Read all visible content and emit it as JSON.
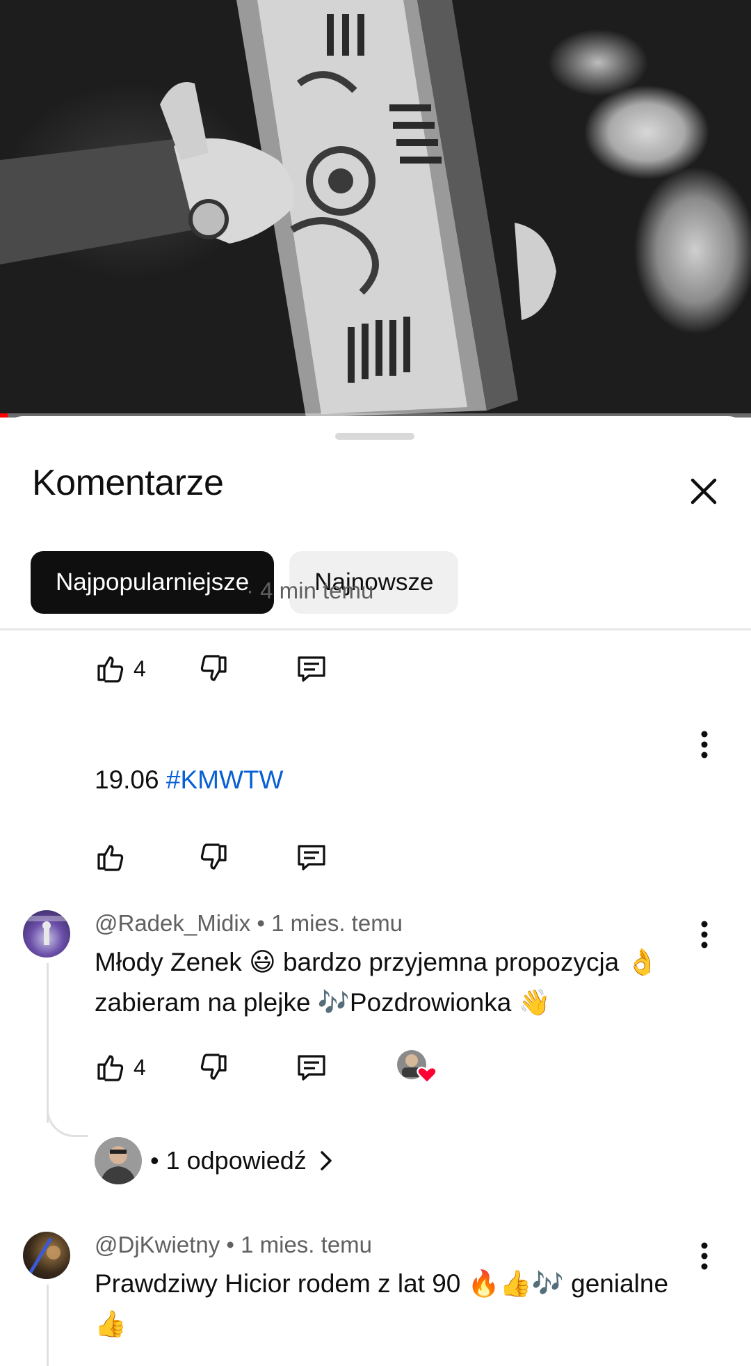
{
  "video": {
    "progress_fraction": 0.01,
    "accent_color": "#ff0000"
  },
  "sheet": {
    "title": "Komentarze",
    "close_icon": "close-icon",
    "filters": [
      {
        "label": "Najpopularniejsze",
        "active": true
      },
      {
        "label": "Najnowsze",
        "active": false
      }
    ]
  },
  "comments": [
    {
      "partial": true,
      "likes": "4"
    },
    {
      "author": "",
      "meta_visible": "· 4 min temu",
      "text_prefix": "19.06 ",
      "hashtag": "#KMWTW",
      "likes": ""
    },
    {
      "author": "@Radek_Midix",
      "time": "• 1 mies. temu",
      "line1": "Młody Zenek 😃 bardzo przyjemna propozycja 👌",
      "line2": "zabieram na plejke 🎶Pozdrowionka 👋",
      "likes": "4",
      "hearted_by_creator": true,
      "replies_label": "• 1 odpowiedź"
    },
    {
      "author": "@DjKwietny",
      "time": "• 1 mies. temu",
      "line1": "Prawdziwy Hicior rodem z lat 90 🔥👍🎶 genialne",
      "line2": "👍"
    }
  ]
}
